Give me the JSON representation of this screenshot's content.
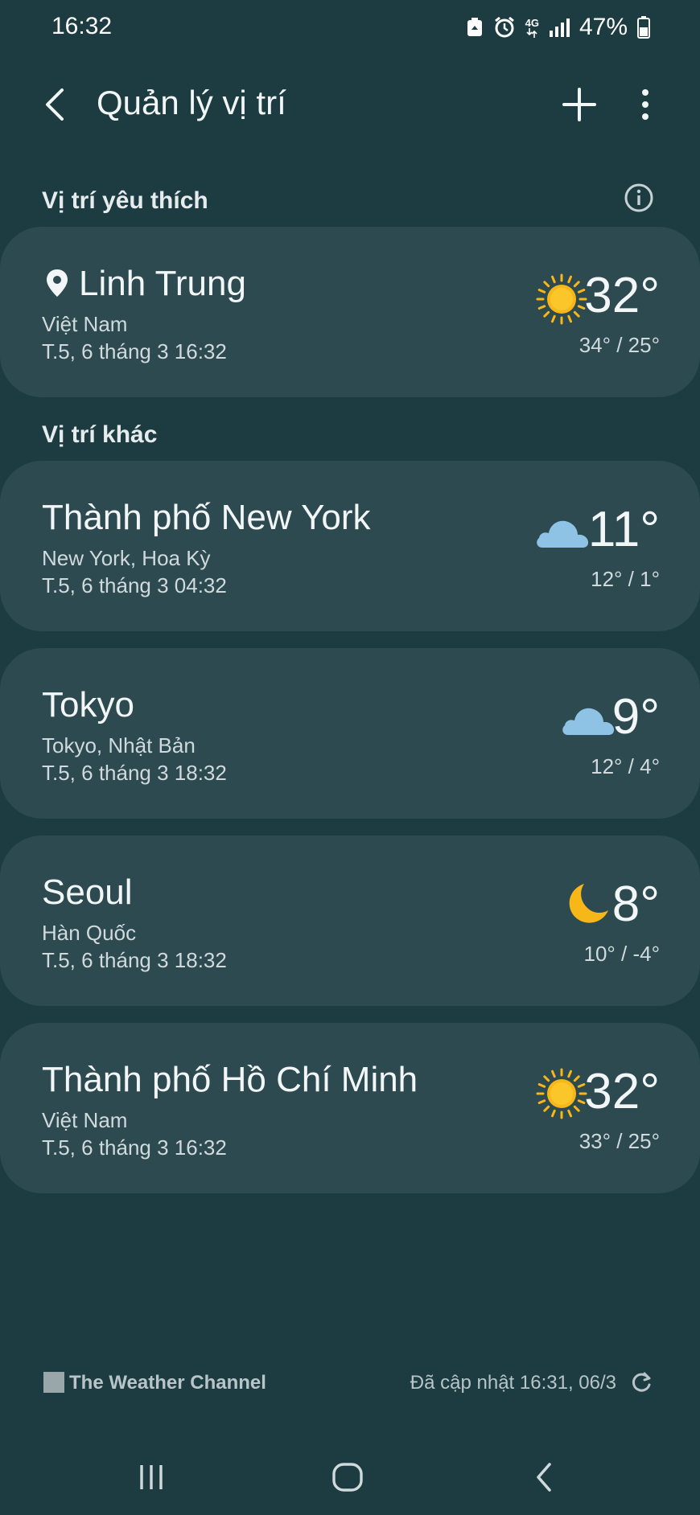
{
  "status_bar": {
    "time": "16:32",
    "network": "4G",
    "battery": "47%"
  },
  "header": {
    "title": "Quản lý vị trí",
    "icons": [
      "back-icon",
      "plus-icon",
      "more-vert-icon"
    ]
  },
  "favorites": {
    "label": "Vị trí yêu thích",
    "items": [
      {
        "name": "Linh Trung",
        "region": "Việt Nam",
        "time": "T.5, 6 tháng 3 16:32",
        "temp": "32°",
        "range": "34° / 25°",
        "icon": "sun-icon"
      }
    ]
  },
  "others": {
    "label": "Vị trí khác",
    "items": [
      {
        "name": "Thành phố New York",
        "region": "New York, Hoa Kỳ",
        "time": "T.5, 6 tháng 3 04:32",
        "temp": "11°",
        "range": "12° / 1°",
        "icon": "cloud-icon"
      },
      {
        "name": "Tokyo",
        "region": "Tokyo, Nhật Bản",
        "time": "T.5, 6 tháng 3 18:32",
        "temp": "9°",
        "range": "12° / 4°",
        "icon": "cloud-icon"
      },
      {
        "name": "Seoul",
        "region": "Hàn Quốc",
        "time": "T.5, 6 tháng 3 18:32",
        "temp": "8°",
        "range": "10° / -4°",
        "icon": "moon-icon"
      },
      {
        "name": "Thành phố Hồ Chí Minh",
        "region": "Việt Nam",
        "time": "T.5, 6 tháng 3 16:32",
        "temp": "32°",
        "range": "33° / 25°",
        "icon": "sun-icon"
      }
    ]
  },
  "footer": {
    "brand": "The Weather Channel",
    "logo_text": "The Weather Channel",
    "updated": "Đã cập nhật 16:31, 06/3"
  },
  "colors": {
    "background": "#1d3c42",
    "card": "#2d4a50",
    "sun": "#f7b718",
    "cloud": "#8ec3e6",
    "moon": "#f7b718"
  }
}
